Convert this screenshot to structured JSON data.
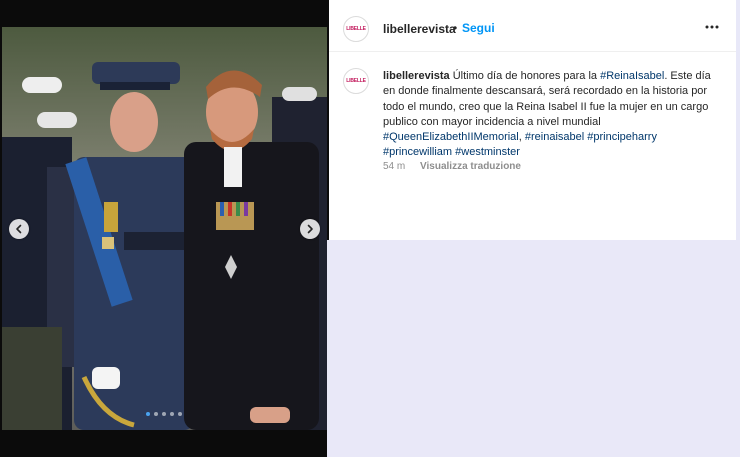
{
  "post": {
    "username": "libellerevista",
    "separator": "•",
    "follow_label": "Segui",
    "avatar_text": "LIBELLE",
    "caption_text": "Último día de honores para la",
    "caption_text_2": ". Este día en donde finalmente descansará, será recordado en la historia por todo el mundo, creo que la Reina Isabel II fue la mujer en un cargo publico con mayor incidencia a nivel mundial",
    "tags": {
      "reinaisabel_cap": "#ReinaIsabel",
      "queen": "#QueenElizabethIIMemorial",
      "reinaisabel": "#reinaisabel",
      "principeharry": "#principeharry",
      "princewilliam": "#princewilliam",
      "westminster": "#westminster"
    },
    "time_ago": "54 m",
    "translate_label": "Visualizza traduzione"
  },
  "carousel": {
    "slide_count": 5,
    "active_index": 0
  },
  "icons": {
    "prev": "chevron-left-icon",
    "next": "chevron-right-icon",
    "more": "more-horizontal-icon"
  },
  "colors": {
    "link": "#0095f6",
    "hashtag": "#00376b",
    "lower_panel": "#e9e8f8"
  }
}
